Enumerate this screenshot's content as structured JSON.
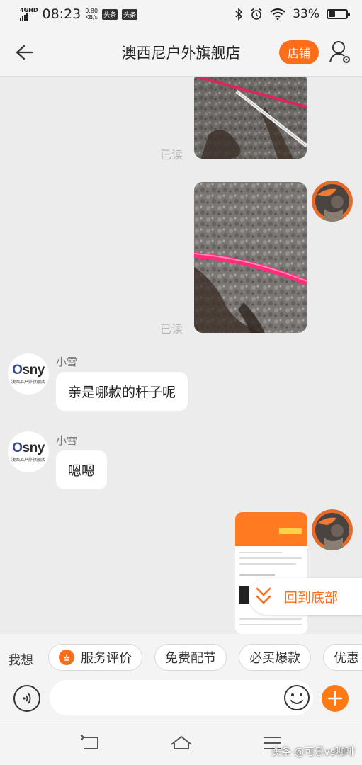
{
  "status_bar": {
    "network": "4G",
    "network_hd": "HD",
    "time": "08:23",
    "speed_value": "0.80",
    "speed_unit": "KB/s",
    "app_badge_1": "头条",
    "app_badge_2": "头条",
    "battery_pct": "33%",
    "battery_level": 0.33,
    "icons": [
      "bluetooth-icon",
      "alarm-icon",
      "wifi-icon",
      "battery-icon"
    ]
  },
  "header": {
    "back_icon": "back-arrow-icon",
    "title": "澳西尼户外旗舰店",
    "shop_button": "店铺",
    "user_icon": "user-settings-icon",
    "accent": "#ff6d1b"
  },
  "messages": [
    {
      "type": "image",
      "side": "right",
      "status": "已读"
    },
    {
      "type": "image",
      "side": "right",
      "status": "已读"
    },
    {
      "type": "text",
      "side": "left",
      "sender": "小雪",
      "text": "亲是哪款的杆子呢"
    },
    {
      "type": "text",
      "side": "left",
      "sender": "小雪",
      "text": "嗯嗯"
    },
    {
      "type": "image",
      "side": "right"
    }
  ],
  "store_avatar": {
    "logo_o": "O",
    "logo_rest": "sny",
    "subtitle": "澳西尼户外旗舰店"
  },
  "back_to_bottom": {
    "label": "回到底部",
    "icon": "double-chevron-down-icon"
  },
  "quick_bar": {
    "label": "我想",
    "chips": [
      {
        "label": "服务评价",
        "icon": "flower-icon"
      },
      {
        "label": "免费配节"
      },
      {
        "label": "必买爆款"
      },
      {
        "label": "优惠"
      }
    ]
  },
  "input_bar": {
    "voice_icon": "voice-icon",
    "placeholder": "",
    "emoji_icon": "emoji-icon",
    "plus_icon": "plus-icon",
    "plus_color": "#ff7a15"
  },
  "nav_bar": {
    "icons": [
      "nav-back-icon",
      "nav-home-icon",
      "nav-menu-icon"
    ],
    "watermark": "头条 @可乐vs咖啡"
  }
}
